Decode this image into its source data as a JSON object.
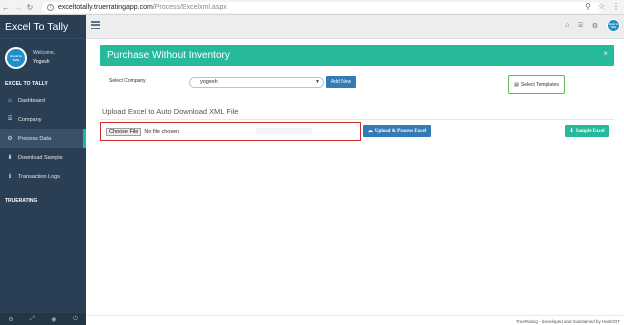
{
  "browser": {
    "url_host": "exceltotally.truerratingapp.com",
    "url_path": "/Process/Excelxml.aspx"
  },
  "sidebar": {
    "brand": "Excel To Tally",
    "welcome": "Welcome,",
    "username": "Yogesh",
    "avatar_text": "Excel to Tally",
    "section_excel": "EXCEL TO TALLY",
    "items": [
      {
        "label": "Dashboard",
        "icon": "home-icon"
      },
      {
        "label": "Company",
        "icon": "bank-icon"
      },
      {
        "label": "Process Data",
        "icon": "gears-icon"
      },
      {
        "label": "Download Sample",
        "icon": "download-icon"
      },
      {
        "label": "Transaction Logs",
        "icon": "info-icon"
      }
    ],
    "section_truerating": "TRUERATING"
  },
  "topnav": {
    "avatar_text": "Excel to Tally"
  },
  "main": {
    "alert_title": "Purchase Without Inventory",
    "alert_close": "×",
    "company_label": "Select Company",
    "company_value": "yogesh",
    "add_new_label": "Add New",
    "select_templates_label": "Select Templates",
    "upload_heading": "Upload Excel to Auto Download XML File",
    "choose_file_label": "Choose File",
    "file_status": "No file chosen",
    "upload_process_label": "Upload & Process Excel",
    "sample_excel_label": "Sample Excel",
    "footer": "TrueRating - developed and maintained by HashIOT"
  },
  "colors": {
    "sidebar_bg": "#2a3f54",
    "alert_green": "#26b99a",
    "primary_blue": "#337ab7",
    "highlight_red": "#c9302c"
  }
}
